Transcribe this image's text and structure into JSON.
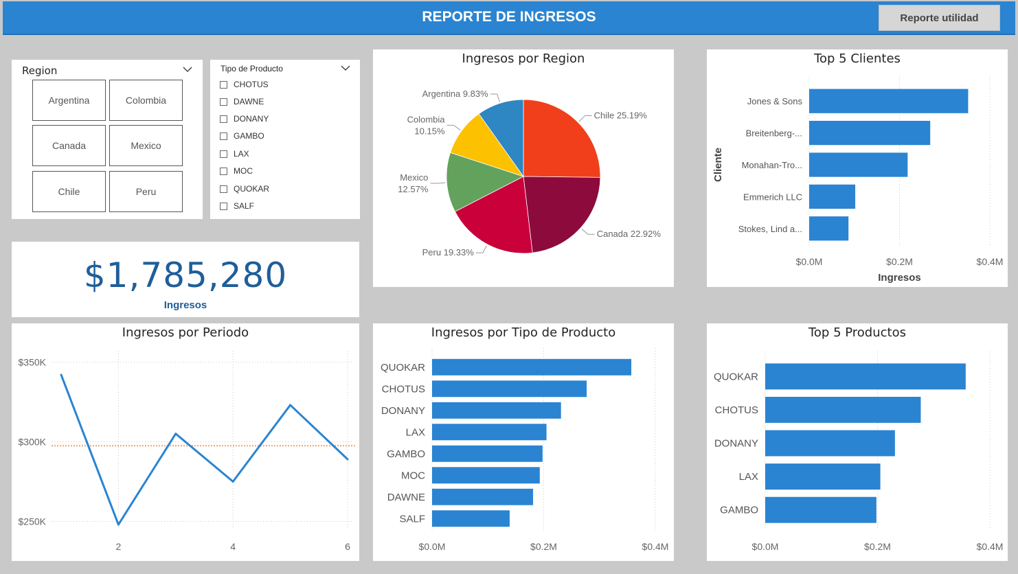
{
  "header": {
    "title": "REPORTE DE INGRESOS",
    "button_label": "Reporte utilidad"
  },
  "region_slicer": {
    "title": "Region",
    "tiles": [
      "Argentina",
      "Colombia",
      "Canada",
      "Mexico",
      "Chile",
      "Peru"
    ]
  },
  "product_slicer": {
    "title": "Tipo de Producto",
    "options": [
      "CHOTUS",
      "DAWNE",
      "DONANY",
      "GAMBO",
      "LAX",
      "MOC",
      "QUOKAR",
      "SALF"
    ]
  },
  "kpi": {
    "value": "$1,785,280",
    "label": "Ingresos"
  },
  "colors": {
    "bar": "#2a84d1",
    "line": "#2a84d1",
    "avg_line": "#f4b183"
  },
  "charts": {
    "pie": {
      "title": "Ingresos por Region",
      "chart_data": {
        "type": "pie",
        "slices": [
          {
            "label": "Chile",
            "value": 25.19,
            "text": "25.19%",
            "color": "#f13f1b"
          },
          {
            "label": "Canada",
            "value": 22.92,
            "text": "22.92%",
            "color": "#8d0a3d"
          },
          {
            "label": "Peru",
            "value": 19.33,
            "text": "19.33%",
            "color": "#c9003a"
          },
          {
            "label": "Mexico",
            "value": 12.57,
            "text": "12.57%",
            "color": "#63a25c"
          },
          {
            "label": "Colombia",
            "value": 10.15,
            "text": "10.15%",
            "color": "#fcc100"
          },
          {
            "label": "Argentina",
            "value": 9.83,
            "text": "9.83%",
            "color": "#2e86c3"
          }
        ]
      }
    },
    "clients": {
      "title": "Top 5 Clientes",
      "chart_data": {
        "type": "bar",
        "orientation": "horizontal",
        "categories": [
          "Jones & Sons",
          "Breitenberg-...",
          "Monahan-Tro...",
          "Emmerich LLC",
          "Stokes, Lind a..."
        ],
        "values": [
          0.352,
          0.268,
          0.218,
          0.102,
          0.087
        ],
        "xlim": [
          0,
          0.4
        ],
        "xticks": [
          "$0.0M",
          "$0.2M",
          "$0.4M"
        ],
        "xlabel": "Ingresos",
        "ylabel": "Cliente"
      }
    },
    "periodo": {
      "title": "Ingresos por Periodo",
      "chart_data": {
        "type": "line",
        "x": [
          1,
          2,
          3,
          4,
          5,
          6
        ],
        "values": [
          342000,
          248000,
          305000,
          275000,
          323000,
          289000
        ],
        "average": 297500,
        "ylim": [
          245000,
          357000
        ],
        "xticks": [
          "2",
          "4",
          "6"
        ],
        "yticks": [
          "$350K",
          "$300K",
          "$250K"
        ]
      }
    },
    "tipo": {
      "title": "Ingresos por Tipo de Producto",
      "chart_data": {
        "type": "bar",
        "orientation": "horizontal",
        "categories": [
          "QUOKAR",
          "CHOTUS",
          "DONANY",
          "LAX",
          "GAMBO",
          "MOC",
          "DAWNE",
          "SALF"
        ],
        "values": [
          0.357,
          0.277,
          0.231,
          0.205,
          0.198,
          0.193,
          0.181,
          0.139
        ],
        "xlim": [
          0,
          0.4
        ],
        "xticks": [
          "$0.0M",
          "$0.2M",
          "$0.4M"
        ]
      }
    },
    "productos": {
      "title": "Top 5 Productos",
      "chart_data": {
        "type": "bar",
        "orientation": "horizontal",
        "categories": [
          "QUOKAR",
          "CHOTUS",
          "DONANY",
          "LAX",
          "GAMBO"
        ],
        "values": [
          0.357,
          0.277,
          0.231,
          0.205,
          0.198
        ],
        "xlim": [
          0,
          0.4
        ],
        "xticks": [
          "$0.0M",
          "$0.2M",
          "$0.4M"
        ]
      }
    }
  }
}
